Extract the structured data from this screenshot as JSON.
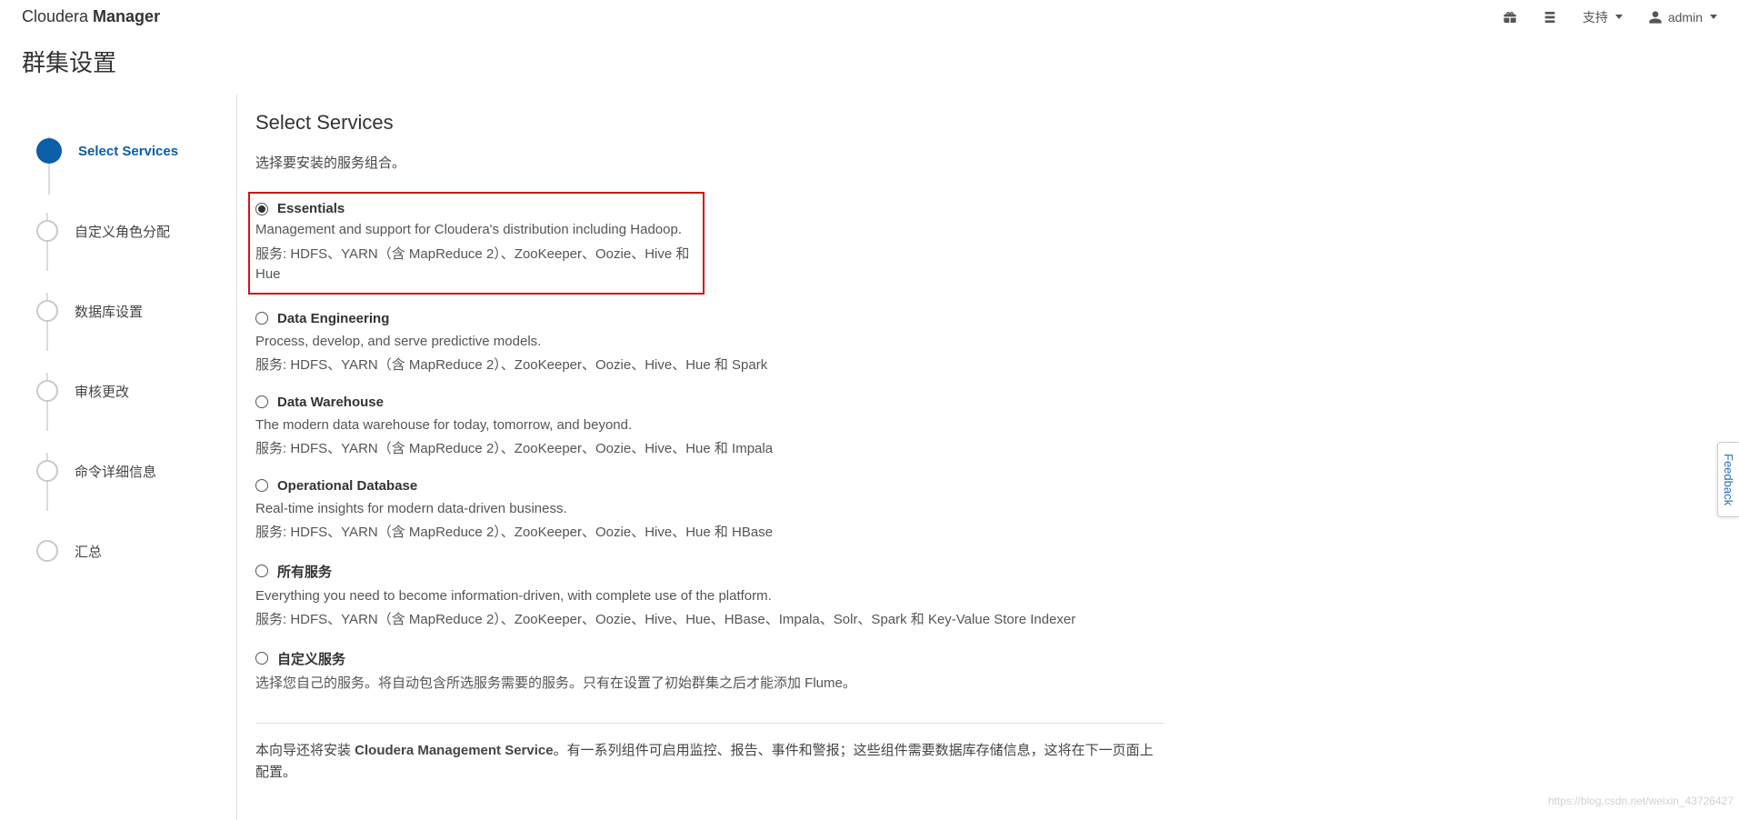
{
  "brand": {
    "light": "Cloudera ",
    "bold": "Manager"
  },
  "topbar": {
    "support": "支持",
    "user": "admin"
  },
  "page_title": "群集设置",
  "steps": [
    {
      "label": "Select Services",
      "active": true
    },
    {
      "label": "自定义角色分配",
      "active": false
    },
    {
      "label": "数据库设置",
      "active": false
    },
    {
      "label": "审核更改",
      "active": false
    },
    {
      "label": "命令详细信息",
      "active": false
    },
    {
      "label": "汇总",
      "active": false
    }
  ],
  "content": {
    "title": "Select Services",
    "subtitle": "选择要安装的服务组合。",
    "options": [
      {
        "name": "Essentials",
        "selected": true,
        "highlight": true,
        "desc": "Management and support for Cloudera's distribution including Hadoop.",
        "services": "服务: HDFS、YARN（含 MapReduce 2）、ZooKeeper、Oozie、Hive 和 Hue"
      },
      {
        "name": "Data Engineering",
        "selected": false,
        "desc": "Process, develop, and serve predictive models.",
        "services": "服务: HDFS、YARN（含 MapReduce 2）、ZooKeeper、Oozie、Hive、Hue 和 Spark"
      },
      {
        "name": "Data Warehouse",
        "selected": false,
        "desc": "The modern data warehouse for today, tomorrow, and beyond.",
        "services": "服务: HDFS、YARN（含 MapReduce 2）、ZooKeeper、Oozie、Hive、Hue 和 Impala"
      },
      {
        "name": "Operational Database",
        "selected": false,
        "desc": "Real-time insights for modern data-driven business.",
        "services": "服务: HDFS、YARN（含 MapReduce 2）、ZooKeeper、Oozie、Hive、Hue 和 HBase"
      },
      {
        "name": "所有服务",
        "selected": false,
        "desc": "Everything you need to become information-driven, with complete use of the platform.",
        "services": "服务: HDFS、YARN（含 MapReduce 2）、ZooKeeper、Oozie、Hive、Hue、HBase、Impala、Solr、Spark 和 Key-Value Store Indexer"
      },
      {
        "name": "自定义服务",
        "selected": false,
        "desc": "选择您自己的服务。将自动包含所选服务需要的服务。只有在设置了初始群集之后才能添加 Flume。",
        "services": ""
      }
    ],
    "footer_pre": "本向导还将安装 ",
    "footer_strong": "Cloudera Management Service",
    "footer_post": "。有一系列组件可启用监控、报告、事件和警报；这些组件需要数据库存储信息，这将在下一页面上配置。"
  },
  "feedback": "Feedback",
  "watermark": "https://blog.csdn.net/weixin_43726427"
}
